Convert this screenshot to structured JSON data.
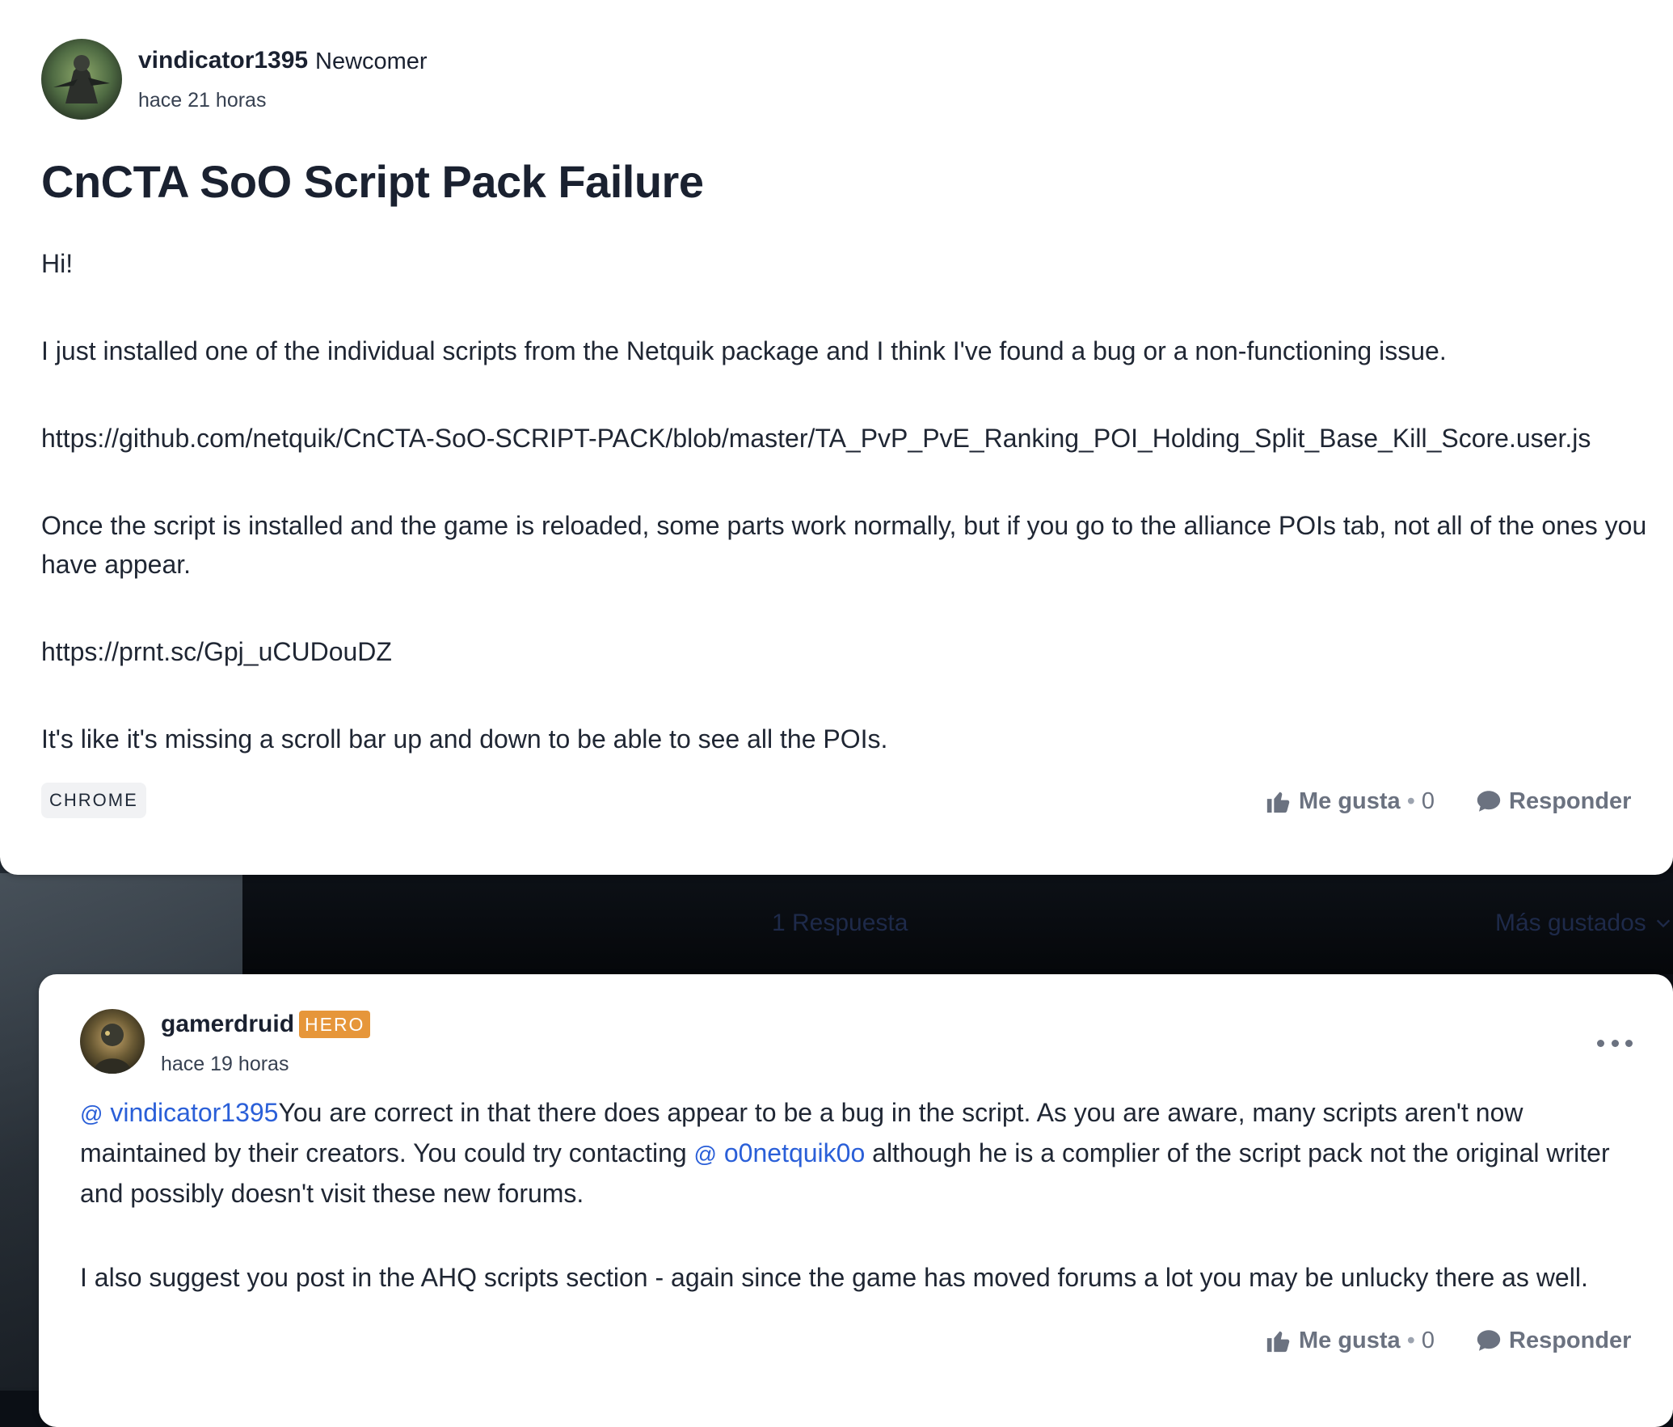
{
  "post": {
    "author": "vindicator1395",
    "rank": "Newcomer",
    "timestamp": "hace 21 horas",
    "title": "CnCTA SoO Script Pack Failure",
    "paragraphs": [
      "Hi!",
      "I just installed one of the individual scripts from the Netquik package and I think I've found a bug or a non-functioning issue.",
      "https://github.com/netquik/CnCTA-SoO-SCRIPT-PACK/blob/master/TA_PvP_PvE_Ranking_POI_Holding_Split_Base_Kill_Score.user.js",
      "Once the script is installed and the game is reloaded, some parts work normally, but if you go to the alliance POIs tab, not all of the ones you have appear.",
      "https://prnt.sc/Gpj_uCUDouDZ",
      "It's like it's missing a scroll bar up and down to be able to see all the POIs."
    ],
    "tag": "CHROME",
    "like_label": "Me gusta",
    "like_separator": "•",
    "like_count": "0",
    "reply_label": "Responder"
  },
  "replies_bar": {
    "count_label": "1 Respuesta",
    "sort_label": "Más gustados"
  },
  "reply": {
    "author": "gamerdruid",
    "badge": "HERO",
    "timestamp": "hace 19 horas",
    "at_symbol": "@",
    "mention_1": "vindicator1395",
    "text_1": "You are correct in that there does appear to be a bug in the script.  As you are aware, many scripts aren't now maintained by their creators.  You could try contacting ",
    "mention_2": "o0netquik0o",
    "text_2": "  although he is a complier of the script pack not the original writer and possibly doesn't visit these new forums.",
    "paragraph_2": "I also suggest you post in the AHQ scripts section - again since the game has moved forums a lot you may be unlucky there as well.",
    "like_label": "Me gusta",
    "like_separator": "•",
    "like_count": "0",
    "reply_label": "Responder"
  },
  "colors": {
    "accent_link": "#2a5fd8",
    "hero_badge": "#e6963a",
    "title": "#1a2130"
  }
}
